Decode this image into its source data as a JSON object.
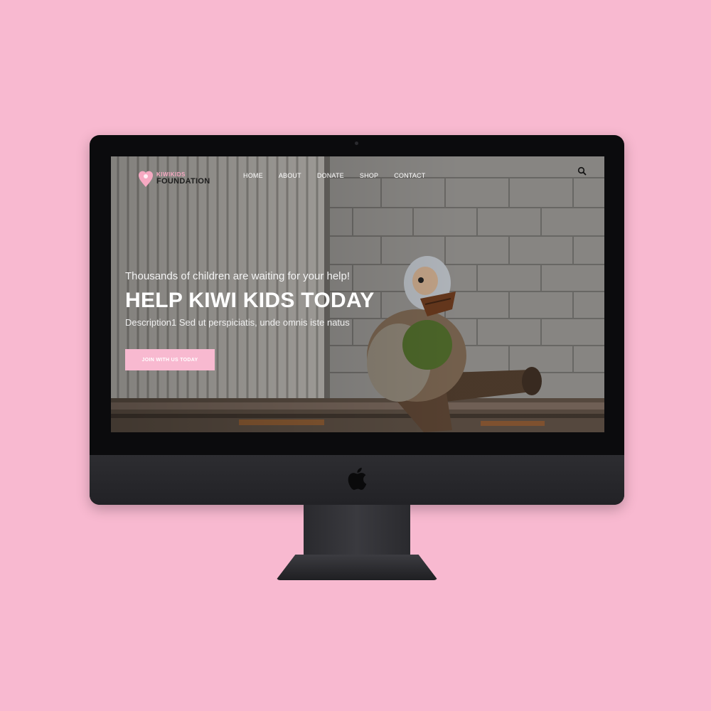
{
  "brand": {
    "name_top": "KIWIKIDS",
    "name_bottom": "FOUNDATION",
    "accent": "#f8b9d0"
  },
  "nav": {
    "items": [
      "HOME",
      "ABOUT",
      "DONATE",
      "SHOP",
      "CONTACT"
    ]
  },
  "hero": {
    "subtitle": "Thousands of children are waiting for your help!",
    "title": "HELP KIWI KIDS TODAY",
    "description": "Description1 Sed ut perspiciatis, unde omnis iste natus",
    "cta_label": "JOIN WITH US TODAY"
  },
  "icons": {
    "search": "search-icon",
    "device_logo": "apple-logo-icon"
  },
  "colors": {
    "background": "#f8b9d0",
    "bezel": "#0b0b0d",
    "chin": "#2d2d31"
  }
}
